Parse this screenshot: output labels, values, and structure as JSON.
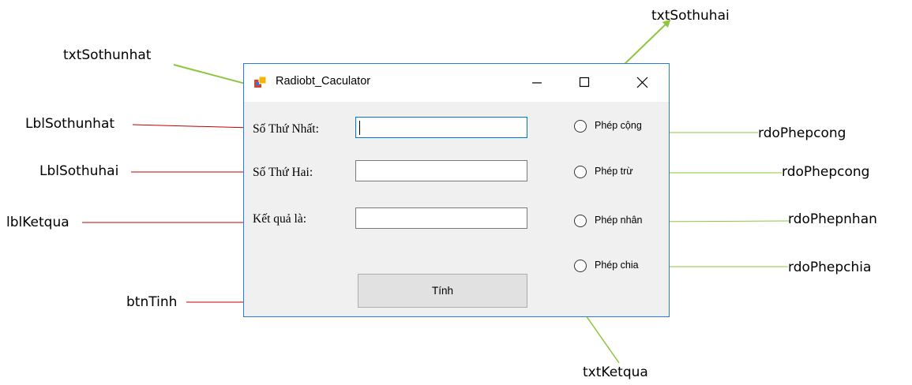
{
  "window": {
    "title": "Radiobt_Caculator",
    "labels": {
      "first_number": "Số Thứ Nhất:",
      "second_number": "Số Thứ Hai:",
      "result": "Kết quả là:"
    },
    "inputs": {
      "first_value": "",
      "second_value": "",
      "result_value": ""
    },
    "radios": [
      "Phép cộng",
      "Phép trừ",
      "Phép nhân",
      "Phép chia"
    ],
    "button_label": "Tính",
    "colors": {
      "window_border": "#2b79d8",
      "focus_border": "#0078d7",
      "annotation_red": "#c00000",
      "annotation_green": "#8cc63f"
    }
  },
  "annotations": {
    "txtSothunhat": "txtSothunhat",
    "txtSothuhai": "txtSothuhai",
    "txtKetqua": "txtKetqua",
    "LblSothunhat": "LblSothunhat",
    "LblSothuhai": "LblSothuhai",
    "lblKetqua": "lblKetqua",
    "btnTinh": "btnTinh",
    "rdo1": "rdoPhepcong",
    "rdo2": "rdoPhepcong",
    "rdo3": "rdoPhepnhan",
    "rdo4": "rdoPhepchia"
  }
}
